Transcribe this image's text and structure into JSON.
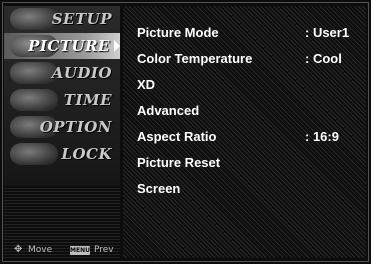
{
  "sidebar": {
    "items": [
      {
        "label": "SETUP",
        "icon": "setup-icon"
      },
      {
        "label": "PICTURE",
        "icon": "picture-icon",
        "selected": true
      },
      {
        "label": "AUDIO",
        "icon": "audio-icon"
      },
      {
        "label": "TIME",
        "icon": "time-icon"
      },
      {
        "label": "OPTION",
        "icon": "option-icon"
      },
      {
        "label": "LOCK",
        "icon": "lock-icon"
      }
    ]
  },
  "hint": {
    "move_icon": "✥",
    "move_label": "Move",
    "menu_key": "MENU",
    "prev_label": "Prev"
  },
  "menu": {
    "rows": [
      {
        "name": "Picture Mode",
        "value": ": User1"
      },
      {
        "name": "Color Temperature",
        "value": ": Cool"
      },
      {
        "name": "XD",
        "value": ""
      },
      {
        "name": "Advanced",
        "value": ""
      },
      {
        "name": "Aspect Ratio",
        "value": ": 16:9"
      },
      {
        "name": "Picture Reset",
        "value": ""
      },
      {
        "name": "Screen",
        "value": ""
      }
    ]
  },
  "colors": {
    "background": "#0c0c0c",
    "text": "#ffffff",
    "selected_tab": "#c9c9c9"
  }
}
